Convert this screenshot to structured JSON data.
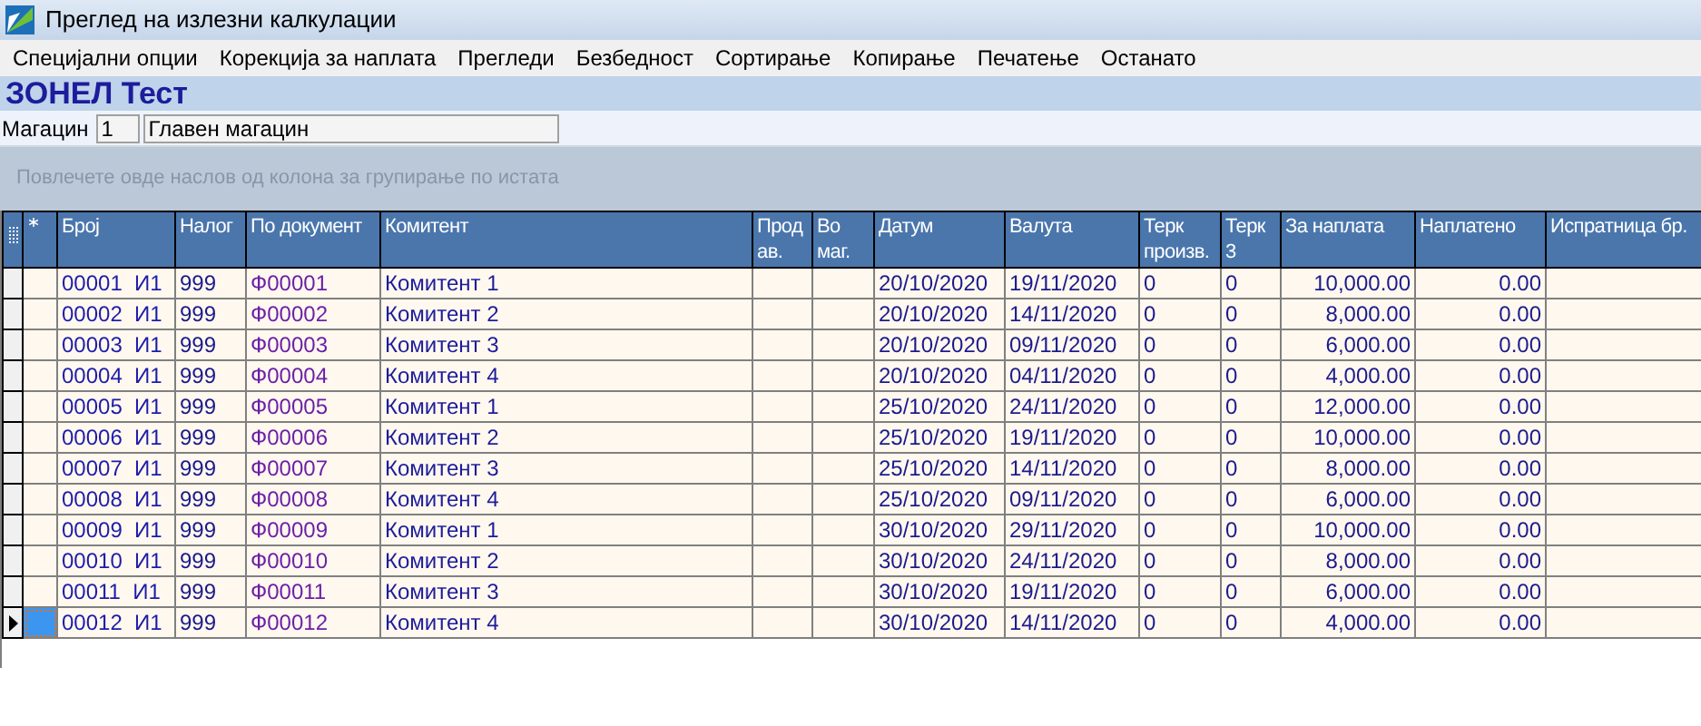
{
  "window": {
    "title": "Преглед на излезни калкулации"
  },
  "menu": [
    "Специјални опции",
    "Корекција за наплата",
    "Прегледи",
    "Безбедност",
    "Сортирање",
    "Копирање",
    "Печатење",
    "Останато"
  ],
  "heading": "ЗОНЕЛ Тест",
  "warehouse": {
    "label": "Магацин",
    "code": "1",
    "name": "Главен магацин"
  },
  "group_hint": "Повлечете овде наслов од колона за групирање по истата",
  "table": {
    "columns": [
      "Број",
      "Налог",
      "По документ",
      "Комитент",
      "Прод ав.",
      "Во маг.",
      "Датум",
      "Валута",
      "Терк произв.",
      "Терк 3",
      "За наплата",
      "Наплатено",
      "Испратница бр."
    ],
    "rows": [
      {
        "selected": false,
        "broj": "00001  И1",
        "nalog": "999",
        "po_dokument": "Ф00001",
        "komitent": "Комитент 1",
        "datum": "20/10/2020",
        "valuta": "19/11/2020",
        "terk_proizv": "0",
        "terk_3": "0",
        "za_naplata": "10,000.00",
        "naplateno": "0.00"
      },
      {
        "selected": false,
        "broj": "00002  И1",
        "nalog": "999",
        "po_dokument": "Ф00002",
        "komitent": "Комитент 2",
        "datum": "20/10/2020",
        "valuta": "14/11/2020",
        "terk_proizv": "0",
        "terk_3": "0",
        "za_naplata": "8,000.00",
        "naplateno": "0.00"
      },
      {
        "selected": false,
        "broj": "00003  И1",
        "nalog": "999",
        "po_dokument": "Ф00003",
        "komitent": "Комитент 3",
        "datum": "20/10/2020",
        "valuta": "09/11/2020",
        "terk_proizv": "0",
        "terk_3": "0",
        "za_naplata": "6,000.00",
        "naplateno": "0.00"
      },
      {
        "selected": false,
        "broj": "00004  И1",
        "nalog": "999",
        "po_dokument": "Ф00004",
        "komitent": "Комитент 4",
        "datum": "20/10/2020",
        "valuta": "04/11/2020",
        "terk_proizv": "0",
        "terk_3": "0",
        "za_naplata": "4,000.00",
        "naplateno": "0.00"
      },
      {
        "selected": false,
        "broj": "00005  И1",
        "nalog": "999",
        "po_dokument": "Ф00005",
        "komitent": "Комитент 1",
        "datum": "25/10/2020",
        "valuta": "24/11/2020",
        "terk_proizv": "0",
        "terk_3": "0",
        "za_naplata": "12,000.00",
        "naplateno": "0.00"
      },
      {
        "selected": false,
        "broj": "00006  И1",
        "nalog": "999",
        "po_dokument": "Ф00006",
        "komitent": "Комитент 2",
        "datum": "25/10/2020",
        "valuta": "19/11/2020",
        "terk_proizv": "0",
        "terk_3": "0",
        "za_naplata": "10,000.00",
        "naplateno": "0.00"
      },
      {
        "selected": false,
        "broj": "00007  И1",
        "nalog": "999",
        "po_dokument": "Ф00007",
        "komitent": "Комитент 3",
        "datum": "25/10/2020",
        "valuta": "14/11/2020",
        "terk_proizv": "0",
        "terk_3": "0",
        "za_naplata": "8,000.00",
        "naplateno": "0.00"
      },
      {
        "selected": false,
        "broj": "00008  И1",
        "nalog": "999",
        "po_dokument": "Ф00008",
        "komitent": "Комитент 4",
        "datum": "25/10/2020",
        "valuta": "09/11/2020",
        "terk_proizv": "0",
        "terk_3": "0",
        "za_naplata": "6,000.00",
        "naplateno": "0.00"
      },
      {
        "selected": false,
        "broj": "00009  И1",
        "nalog": "999",
        "po_dokument": "Ф00009",
        "komitent": "Комитент 1",
        "datum": "30/10/2020",
        "valuta": "29/11/2020",
        "terk_proizv": "0",
        "terk_3": "0",
        "za_naplata": "10,000.00",
        "naplateno": "0.00"
      },
      {
        "selected": false,
        "broj": "00010  И1",
        "nalog": "999",
        "po_dokument": "Ф00010",
        "komitent": "Комитент 2",
        "datum": "30/10/2020",
        "valuta": "24/11/2020",
        "terk_proizv": "0",
        "terk_3": "0",
        "za_naplata": "8,000.00",
        "naplateno": "0.00"
      },
      {
        "selected": false,
        "broj": "00011  И1",
        "nalog": "999",
        "po_dokument": "Ф00011",
        "komitent": "Комитент 3",
        "datum": "30/10/2020",
        "valuta": "19/11/2020",
        "terk_proizv": "0",
        "terk_3": "0",
        "za_naplata": "6,000.00",
        "naplateno": "0.00"
      },
      {
        "selected": true,
        "broj": "00012  И1",
        "nalog": "999",
        "po_dokument": "Ф00012",
        "komitent": "Комитент 4",
        "datum": "30/10/2020",
        "valuta": "14/11/2020",
        "terk_proizv": "0",
        "terk_3": "0",
        "za_naplata": "4,000.00",
        "naplateno": "0.00"
      }
    ]
  }
}
